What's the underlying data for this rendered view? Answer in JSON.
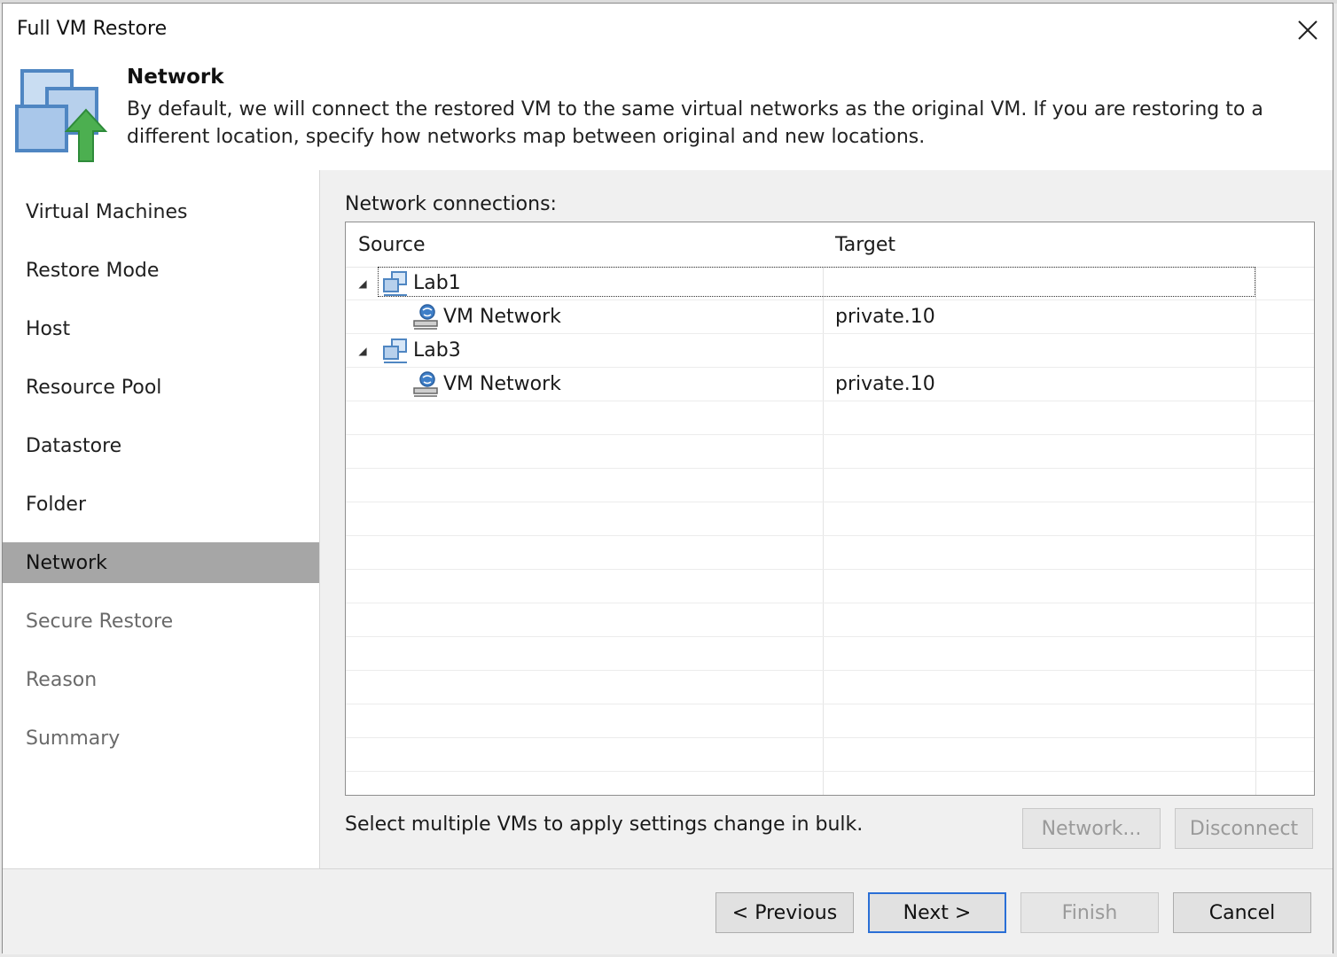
{
  "window": {
    "title": "Full VM Restore",
    "close_icon": "close-icon"
  },
  "header": {
    "title": "Network",
    "description": "By default, we will connect the restored VM to the same virtual networks as the original VM. If you are restoring to a different location, specify how networks map between original and new locations.",
    "icon": "restore-vm-icon"
  },
  "sidebar": {
    "items": [
      {
        "label": "Virtual Machines",
        "state": "done"
      },
      {
        "label": "Restore Mode",
        "state": "done"
      },
      {
        "label": "Host",
        "state": "done"
      },
      {
        "label": "Resource Pool",
        "state": "done"
      },
      {
        "label": "Datastore",
        "state": "done"
      },
      {
        "label": "Folder",
        "state": "done"
      },
      {
        "label": "Network",
        "state": "active"
      },
      {
        "label": "Secure Restore",
        "state": "pending"
      },
      {
        "label": "Reason",
        "state": "pending"
      },
      {
        "label": "Summary",
        "state": "pending"
      }
    ]
  },
  "main": {
    "section_label": "Network connections:",
    "columns": [
      "Source",
      "Target"
    ],
    "rows": [
      {
        "type": "vm",
        "source": "Lab1",
        "target": "",
        "expanded": true,
        "focused": true,
        "icon": "vm-icon"
      },
      {
        "type": "network",
        "source": "VM Network",
        "target": "private.10",
        "icon": "network-icon"
      },
      {
        "type": "vm",
        "source": "Lab3",
        "target": "",
        "expanded": true,
        "focused": false,
        "icon": "vm-icon"
      },
      {
        "type": "network",
        "source": "VM Network",
        "target": "private.10",
        "icon": "network-icon"
      }
    ],
    "hint": "Select multiple VMs to apply settings change in bulk.",
    "network_button": "Network...",
    "disconnect_button": "Disconnect"
  },
  "footer": {
    "previous": "< Previous",
    "next": "Next >",
    "finish": "Finish",
    "cancel": "Cancel"
  },
  "colors": {
    "active_nav": "#a6a6a6",
    "default_button_border": "#2a6fd6",
    "arrow_green": "#4caf50",
    "vm_blue": "#6fa0d6"
  }
}
